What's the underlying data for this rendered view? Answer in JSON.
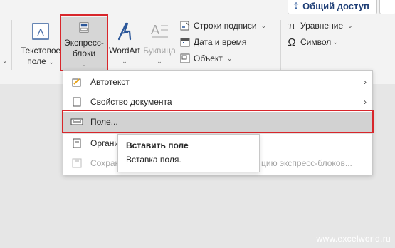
{
  "header": {
    "share_label": "Общий доступ"
  },
  "ribbon": {
    "textbox": {
      "line1": "Текстовое",
      "line2": "поле"
    },
    "quickparts": {
      "line1": "Экспресс-",
      "line2": "блоки"
    },
    "wordart": {
      "label": "WordArt"
    },
    "dropcap": {
      "label": "Буквица"
    },
    "signature_line": "Строки подписи",
    "date_time": "Дата и время",
    "object": "Объект",
    "equation": "Уравнение",
    "symbol": "Символ"
  },
  "menu": {
    "items": [
      {
        "label": "Автотекст",
        "icon": "autotext-icon"
      },
      {
        "label": "Свойство документа",
        "icon": "document-property-icon"
      },
      {
        "label": "Поле...",
        "icon": "field-icon"
      },
      {
        "label": "Органи",
        "icon": "organizer-icon"
      },
      {
        "label": "Сохран",
        "icon": "save-selection-icon",
        "suffix": "цию экспресс-блоков..."
      }
    ]
  },
  "tooltip": {
    "title": "Вставить поле",
    "description": "Вставка поля."
  },
  "watermark": "www.excelworld.ru",
  "colors": {
    "accent": "#2b579a",
    "highlight_border": "#d8262b",
    "menu_highlight": "#d2d2d2"
  }
}
